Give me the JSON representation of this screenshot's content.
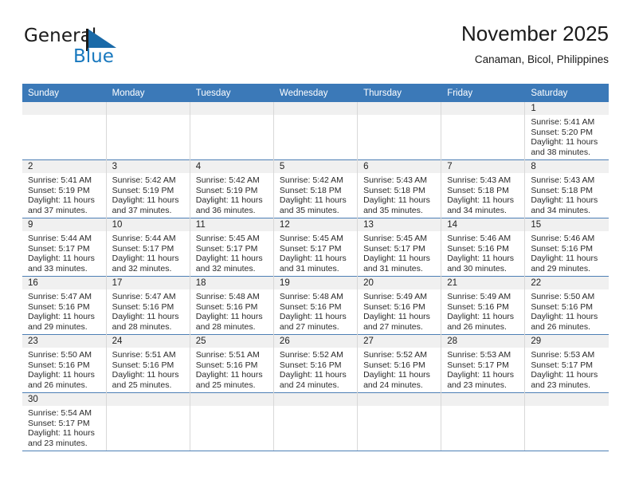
{
  "brand": {
    "name_part1": "General",
    "name_part2": "Blue",
    "flag_icon": "blue-triangle-flag-icon",
    "color_primary": "#1878be",
    "color_text": "#1a1a1a"
  },
  "header": {
    "title": "November 2025",
    "subtitle": "Canaman, Bicol, Philippines"
  },
  "theme": {
    "header_row_bg": "#3b79b8",
    "header_row_text": "#ffffff",
    "daynum_band_bg": "#f0f0f0",
    "week_separator": "#4d7fb5",
    "column_separator": "#d8d8d8"
  },
  "weekdays": [
    "Sunday",
    "Monday",
    "Tuesday",
    "Wednesday",
    "Thursday",
    "Friday",
    "Saturday"
  ],
  "labels": {
    "sunrise_prefix": "Sunrise:",
    "sunset_prefix": "Sunset:",
    "daylight_prefix": "Daylight:"
  },
  "weeks": [
    [
      {
        "day": "",
        "empty": true
      },
      {
        "day": "",
        "empty": true
      },
      {
        "day": "",
        "empty": true
      },
      {
        "day": "",
        "empty": true
      },
      {
        "day": "",
        "empty": true
      },
      {
        "day": "",
        "empty": true
      },
      {
        "day": "1",
        "sunrise": "Sunrise: 5:41 AM",
        "sunset": "Sunset: 5:20 PM",
        "daylight_1": "Daylight: 11 hours",
        "daylight_2": "and 38 minutes."
      }
    ],
    [
      {
        "day": "2",
        "sunrise": "Sunrise: 5:41 AM",
        "sunset": "Sunset: 5:19 PM",
        "daylight_1": "Daylight: 11 hours",
        "daylight_2": "and 37 minutes."
      },
      {
        "day": "3",
        "sunrise": "Sunrise: 5:42 AM",
        "sunset": "Sunset: 5:19 PM",
        "daylight_1": "Daylight: 11 hours",
        "daylight_2": "and 37 minutes."
      },
      {
        "day": "4",
        "sunrise": "Sunrise: 5:42 AM",
        "sunset": "Sunset: 5:19 PM",
        "daylight_1": "Daylight: 11 hours",
        "daylight_2": "and 36 minutes."
      },
      {
        "day": "5",
        "sunrise": "Sunrise: 5:42 AM",
        "sunset": "Sunset: 5:18 PM",
        "daylight_1": "Daylight: 11 hours",
        "daylight_2": "and 35 minutes."
      },
      {
        "day": "6",
        "sunrise": "Sunrise: 5:43 AM",
        "sunset": "Sunset: 5:18 PM",
        "daylight_1": "Daylight: 11 hours",
        "daylight_2": "and 35 minutes."
      },
      {
        "day": "7",
        "sunrise": "Sunrise: 5:43 AM",
        "sunset": "Sunset: 5:18 PM",
        "daylight_1": "Daylight: 11 hours",
        "daylight_2": "and 34 minutes."
      },
      {
        "day": "8",
        "sunrise": "Sunrise: 5:43 AM",
        "sunset": "Sunset: 5:18 PM",
        "daylight_1": "Daylight: 11 hours",
        "daylight_2": "and 34 minutes."
      }
    ],
    [
      {
        "day": "9",
        "sunrise": "Sunrise: 5:44 AM",
        "sunset": "Sunset: 5:17 PM",
        "daylight_1": "Daylight: 11 hours",
        "daylight_2": "and 33 minutes."
      },
      {
        "day": "10",
        "sunrise": "Sunrise: 5:44 AM",
        "sunset": "Sunset: 5:17 PM",
        "daylight_1": "Daylight: 11 hours",
        "daylight_2": "and 32 minutes."
      },
      {
        "day": "11",
        "sunrise": "Sunrise: 5:45 AM",
        "sunset": "Sunset: 5:17 PM",
        "daylight_1": "Daylight: 11 hours",
        "daylight_2": "and 32 minutes."
      },
      {
        "day": "12",
        "sunrise": "Sunrise: 5:45 AM",
        "sunset": "Sunset: 5:17 PM",
        "daylight_1": "Daylight: 11 hours",
        "daylight_2": "and 31 minutes."
      },
      {
        "day": "13",
        "sunrise": "Sunrise: 5:45 AM",
        "sunset": "Sunset: 5:17 PM",
        "daylight_1": "Daylight: 11 hours",
        "daylight_2": "and 31 minutes."
      },
      {
        "day": "14",
        "sunrise": "Sunrise: 5:46 AM",
        "sunset": "Sunset: 5:16 PM",
        "daylight_1": "Daylight: 11 hours",
        "daylight_2": "and 30 minutes."
      },
      {
        "day": "15",
        "sunrise": "Sunrise: 5:46 AM",
        "sunset": "Sunset: 5:16 PM",
        "daylight_1": "Daylight: 11 hours",
        "daylight_2": "and 29 minutes."
      }
    ],
    [
      {
        "day": "16",
        "sunrise": "Sunrise: 5:47 AM",
        "sunset": "Sunset: 5:16 PM",
        "daylight_1": "Daylight: 11 hours",
        "daylight_2": "and 29 minutes."
      },
      {
        "day": "17",
        "sunrise": "Sunrise: 5:47 AM",
        "sunset": "Sunset: 5:16 PM",
        "daylight_1": "Daylight: 11 hours",
        "daylight_2": "and 28 minutes."
      },
      {
        "day": "18",
        "sunrise": "Sunrise: 5:48 AM",
        "sunset": "Sunset: 5:16 PM",
        "daylight_1": "Daylight: 11 hours",
        "daylight_2": "and 28 minutes."
      },
      {
        "day": "19",
        "sunrise": "Sunrise: 5:48 AM",
        "sunset": "Sunset: 5:16 PM",
        "daylight_1": "Daylight: 11 hours",
        "daylight_2": "and 27 minutes."
      },
      {
        "day": "20",
        "sunrise": "Sunrise: 5:49 AM",
        "sunset": "Sunset: 5:16 PM",
        "daylight_1": "Daylight: 11 hours",
        "daylight_2": "and 27 minutes."
      },
      {
        "day": "21",
        "sunrise": "Sunrise: 5:49 AM",
        "sunset": "Sunset: 5:16 PM",
        "daylight_1": "Daylight: 11 hours",
        "daylight_2": "and 26 minutes."
      },
      {
        "day": "22",
        "sunrise": "Sunrise: 5:50 AM",
        "sunset": "Sunset: 5:16 PM",
        "daylight_1": "Daylight: 11 hours",
        "daylight_2": "and 26 minutes."
      }
    ],
    [
      {
        "day": "23",
        "sunrise": "Sunrise: 5:50 AM",
        "sunset": "Sunset: 5:16 PM",
        "daylight_1": "Daylight: 11 hours",
        "daylight_2": "and 26 minutes."
      },
      {
        "day": "24",
        "sunrise": "Sunrise: 5:51 AM",
        "sunset": "Sunset: 5:16 PM",
        "daylight_1": "Daylight: 11 hours",
        "daylight_2": "and 25 minutes."
      },
      {
        "day": "25",
        "sunrise": "Sunrise: 5:51 AM",
        "sunset": "Sunset: 5:16 PM",
        "daylight_1": "Daylight: 11 hours",
        "daylight_2": "and 25 minutes."
      },
      {
        "day": "26",
        "sunrise": "Sunrise: 5:52 AM",
        "sunset": "Sunset: 5:16 PM",
        "daylight_1": "Daylight: 11 hours",
        "daylight_2": "and 24 minutes."
      },
      {
        "day": "27",
        "sunrise": "Sunrise: 5:52 AM",
        "sunset": "Sunset: 5:16 PM",
        "daylight_1": "Daylight: 11 hours",
        "daylight_2": "and 24 minutes."
      },
      {
        "day": "28",
        "sunrise": "Sunrise: 5:53 AM",
        "sunset": "Sunset: 5:17 PM",
        "daylight_1": "Daylight: 11 hours",
        "daylight_2": "and 23 minutes."
      },
      {
        "day": "29",
        "sunrise": "Sunrise: 5:53 AM",
        "sunset": "Sunset: 5:17 PM",
        "daylight_1": "Daylight: 11 hours",
        "daylight_2": "and 23 minutes."
      }
    ],
    [
      {
        "day": "30",
        "sunrise": "Sunrise: 5:54 AM",
        "sunset": "Sunset: 5:17 PM",
        "daylight_1": "Daylight: 11 hours",
        "daylight_2": "and 23 minutes."
      },
      {
        "day": "",
        "empty": true
      },
      {
        "day": "",
        "empty": true
      },
      {
        "day": "",
        "empty": true
      },
      {
        "day": "",
        "empty": true
      },
      {
        "day": "",
        "empty": true
      },
      {
        "day": "",
        "empty": true
      }
    ]
  ]
}
